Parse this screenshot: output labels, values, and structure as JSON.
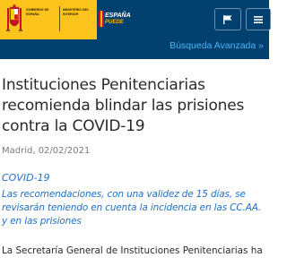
{
  "header": {
    "government_label": "Gobierno de España",
    "ministry_label": "Ministerio del Interior",
    "brand_line1": "ESPAÑA",
    "brand_line2": "PUEDE",
    "language_icon": "flag-icon",
    "menu_icon": "menu-icon",
    "advanced_search_label": "Búsqueda Avanzada »",
    "colors": {
      "header_bg": "#01406f",
      "logo_bg": "#fbc31b",
      "link": "#4fb3f7"
    }
  },
  "article": {
    "title": "Instituciones Penitenciarias recomienda blindar las prisiones contra la COVID-19",
    "date": "Madrid, 02/02/2021",
    "category": "COVID-19",
    "summary": "Las recomendaciones, con una validez de 15 días, se revisarán teniendo en cuenta la incidencia en las CC.AA. y en las prisiones",
    "body_first_line": "La Secretaría General de Instituciones Penitenciarias ha",
    "colors": {
      "accent": "#1f6fc3",
      "text": "#2a2a2a",
      "muted": "#7a7a7a"
    }
  }
}
